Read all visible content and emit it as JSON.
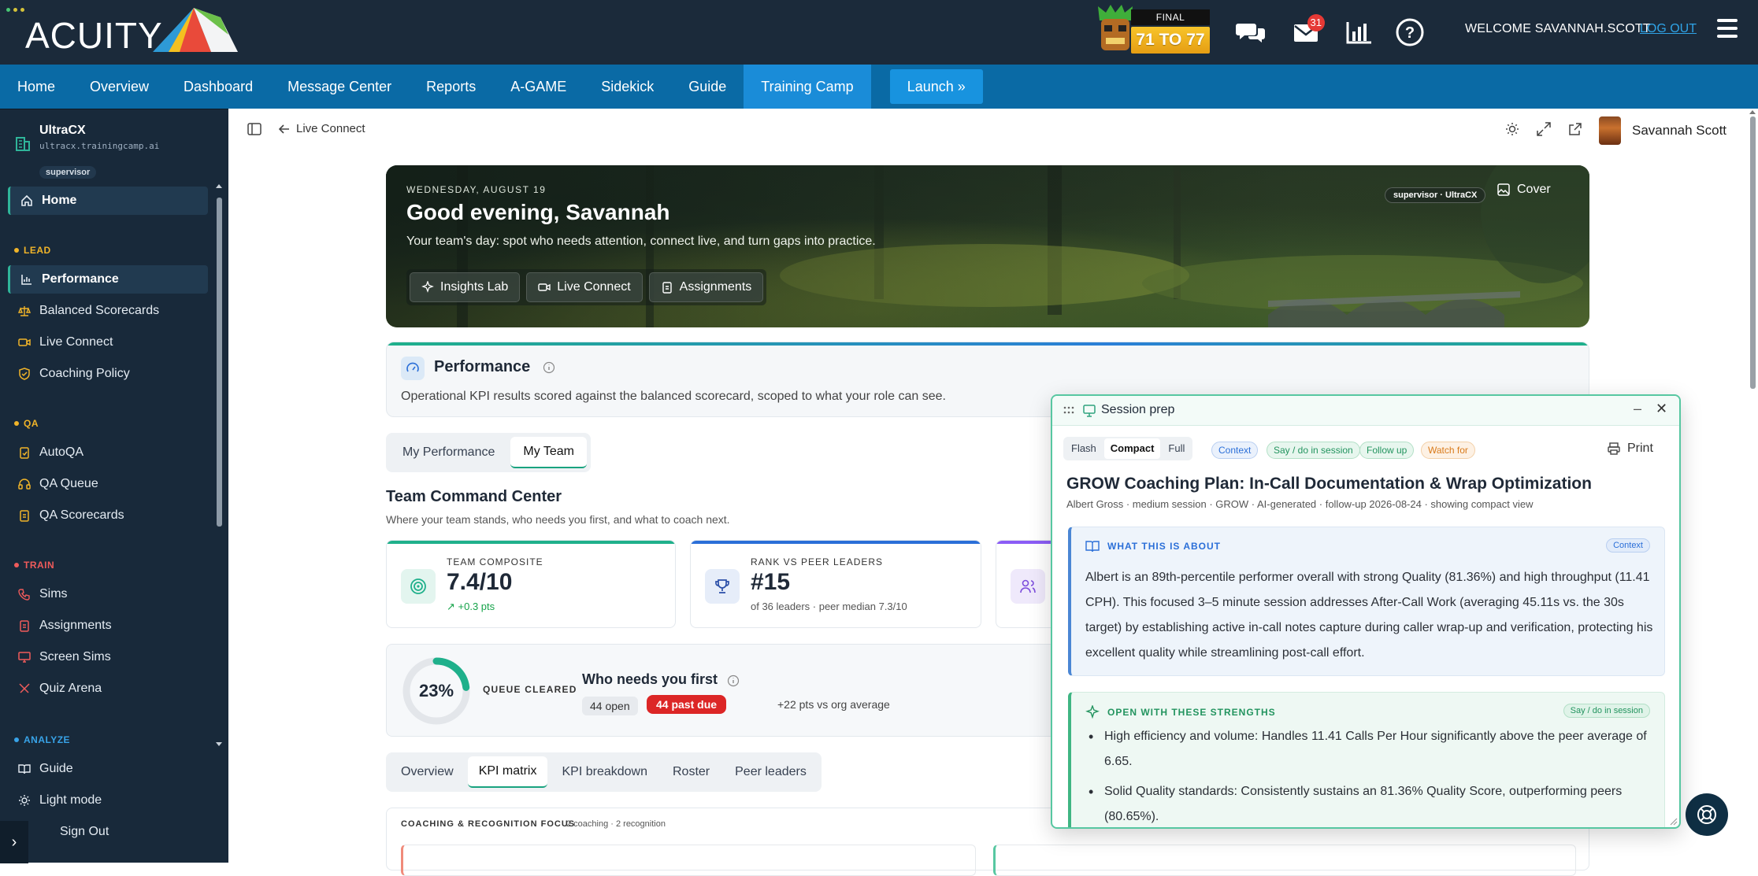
{
  "topbar": {
    "logo_text": "ACUITY",
    "logo_tm": "™",
    "score": {
      "final_label": "FINAL",
      "result": "71 TO 77"
    },
    "mail_count": "31",
    "welcome": "WELCOME SAVANNAH.SCOTT",
    "logout": "LOG OUT"
  },
  "nav": {
    "items": [
      {
        "label": "Home"
      },
      {
        "label": "Overview"
      },
      {
        "label": "Dashboard"
      },
      {
        "label": "Message Center"
      },
      {
        "label": "Reports"
      },
      {
        "label": "A-GAME"
      },
      {
        "label": "Sidekick"
      },
      {
        "label": "Guide"
      },
      {
        "label": "Training Camp",
        "active": true
      }
    ],
    "launch": "Launch »"
  },
  "sidebar": {
    "org_name": "UltraCX",
    "org_url": "ultracx.trainingcamp.ai",
    "org_role": "supervisor",
    "home": "Home",
    "sections": {
      "lead": "LEAD",
      "qa": "QA",
      "train": "TRAIN",
      "analyze": "ANALYZE"
    },
    "section_colors": {
      "lead": "#f0b429",
      "qa": "#f0b429",
      "train": "#ef5b5b",
      "analyze": "#38a3e8"
    },
    "lead_items": [
      "Performance",
      "Balanced Scorecards",
      "Live Connect",
      "Coaching Policy"
    ],
    "qa_items": [
      "AutoQA",
      "QA Queue",
      "QA Scorecards"
    ],
    "train_items": [
      "Sims",
      "Assignments",
      "Screen Sims",
      "Quiz Arena"
    ],
    "analyze_items": [
      "Guide",
      "Light mode",
      "Sign Out"
    ],
    "collapse_glyph": "›"
  },
  "subbar": {
    "crumb": "Live Connect",
    "user_name": "Savannah Scott"
  },
  "hero": {
    "date": "WEDNESDAY, AUGUST 19",
    "title": "Good evening, Savannah",
    "subtitle": "Your team's day: spot who needs attention, connect live, and turn gaps into practice.",
    "actions": [
      "Insights Lab",
      "Live Connect",
      "Assignments"
    ],
    "role_badge": "supervisor · UltraCX",
    "cover": "Cover"
  },
  "performance": {
    "title": "Performance",
    "description": "Operational KPI results scored against the balanced scorecard, scoped to what your role can see.",
    "toggle": [
      "My Performance",
      "My Team"
    ],
    "toggle_active": "My Team"
  },
  "command_center": {
    "title": "Team Command Center",
    "subtitle": "Where your team stands, who needs you first, and what to coach next.",
    "kpis": [
      {
        "label": "TEAM COMPOSITE",
        "value": "7.4/10",
        "note": "+0.3 pts",
        "accent": "#1fb08b"
      },
      {
        "label": "RANK VS PEER LEADERS",
        "value": "#15",
        "note": "of 36 leaders · peer median 7.3/10",
        "accent": "#2b6fd8"
      }
    ],
    "queue": {
      "percent_label": "23%",
      "percent": 0.23,
      "cleared_label": "QUEUE CLEARED",
      "title": "Who needs you first",
      "open": "44 open",
      "past_due": "44 past due",
      "delta": "+22 pts vs org average"
    },
    "tabs": [
      "Overview",
      "KPI matrix",
      "KPI breakdown",
      "Roster",
      "Peer leaders"
    ],
    "tab_active": "KPI matrix",
    "focus": {
      "label": "COACHING & RECOGNITION FOCUS",
      "sub": "2 coaching · 2 recognition"
    }
  },
  "session_prep": {
    "title": "Session prep",
    "modes": [
      "Flash",
      "Compact",
      "Full"
    ],
    "mode_active": "Compact",
    "chips": [
      "Context",
      "Say / do in session",
      "Follow up",
      "Watch for"
    ],
    "print": "Print",
    "plan_title": "GROW Coaching Plan: In-Call Documentation & Wrap Optimization",
    "meta": "Albert Gross · medium session · GROW · AI-generated · follow-up 2026-08-24 · showing compact view",
    "about": {
      "heading": "WHAT THIS IS ABOUT",
      "tag": "Context",
      "body": "Albert is an 89th-percentile performer overall with strong Quality (81.36%) and high throughput (11.41 CPH). This focused 3–5 minute session addresses After-Call Work (averaging 45.11s vs. the 30s target) by establishing active in-call notes capture during caller wrap-up and verification, protecting his excellent quality while streamlining post-call effort."
    },
    "strengths": {
      "heading": "OPEN WITH THESE STRENGTHS",
      "tag": "Say / do in session",
      "items": [
        "High efficiency and volume: Handles 11.41 Calls Per Hour significantly above the peer average of 6.65.",
        "Solid Quality standards: Consistently sustains an 81.36% Quality Score, outperforming peers (80.65%)."
      ]
    }
  }
}
